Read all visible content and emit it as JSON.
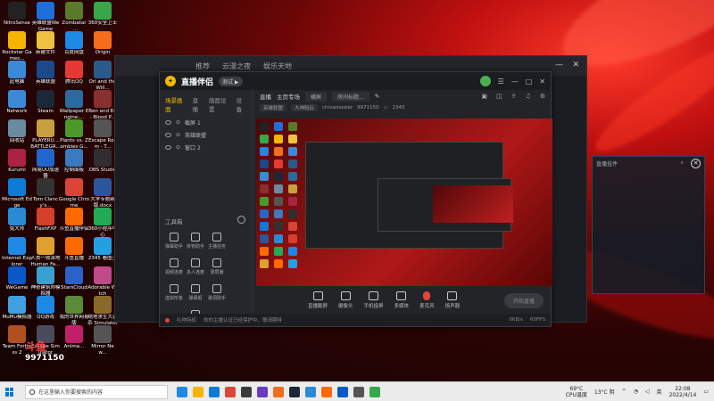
{
  "desktop_icons": [
    {
      "label": "NitroSense",
      "color": "#222222"
    },
    {
      "label": "英雄联盟WeGame",
      "color": "#1e6fd9"
    },
    {
      "label": "Zombatar_...",
      "color": "#5a7a2a"
    },
    {
      "label": "360安全卫士",
      "color": "#36a84a"
    },
    {
      "label": "Rockstar Games...",
      "color": "#f4b400"
    },
    {
      "label": "新建文件",
      "color": "#f0c040"
    },
    {
      "label": "百度网盘",
      "color": "#1e88e5"
    },
    {
      "label": "Origin",
      "color": "#f56c1d"
    },
    {
      "label": "此电脑",
      "color": "#3a8ad6"
    },
    {
      "label": "英雄联盟",
      "color": "#1b4a8a"
    },
    {
      "label": "腾讯QQ",
      "color": "#e53935"
    },
    {
      "label": "Ori and the Will...",
      "color": "#2a5a8a"
    },
    {
      "label": "Network",
      "color": "#3a8ad6"
    },
    {
      "label": "Steam",
      "color": "#1b2838"
    },
    {
      "label": "Wallpaper Engine:...",
      "color": "#2a6aa0"
    },
    {
      "label": "Ben and Ed - Blood P...",
      "color": "#883030"
    },
    {
      "label": "回收站",
      "color": "#6a8aa0"
    },
    {
      "label": "PLAYERU... BATTLEGR...",
      "color": "#c8a040"
    },
    {
      "label": "Plants vs. Zombies G...",
      "color": "#4a9a2a"
    },
    {
      "label": "Escape Room - T...",
      "color": "#555555"
    },
    {
      "label": "Kurumi",
      "color": "#aa2244"
    },
    {
      "label": "网易UU加速器",
      "color": "#2266cc"
    },
    {
      "label": "控制面板",
      "color": "#3a7ac0"
    },
    {
      "label": "OBS Studio",
      "color": "#302e31"
    },
    {
      "label": "Microsoft Edge",
      "color": "#0c7bd6"
    },
    {
      "label": "Tom Clancy's...",
      "color": "#333333"
    },
    {
      "label": "Google Chrome",
      "color": "#db4437"
    },
    {
      "label": "大学专题新版.docx",
      "color": "#2b579a"
    },
    {
      "label": "兔大师",
      "color": "#2a8ad6"
    },
    {
      "label": "FlashFXP",
      "color": "#d6402a"
    },
    {
      "label": "斗鱼直播伴侣",
      "color": "#ff6a00"
    },
    {
      "label": "360小程序中心",
      "color": "#22aa55"
    },
    {
      "label": "Internet Explorer",
      "color": "#1e88e5"
    },
    {
      "label": "人类一败涂地 Human Fa...",
      "color": "#e0a030"
    },
    {
      "label": "斗鱼直播",
      "color": "#ff6a00"
    },
    {
      "label": "2345 看图王",
      "color": "#22a0e0"
    },
    {
      "label": "WeGame",
      "color": "#0a58c8"
    },
    {
      "label": "神奇建筑师模拟器",
      "color": "#3aa0d0"
    },
    {
      "label": "StarsCloud",
      "color": "#2a62c8"
    },
    {
      "label": "Adorable Witch",
      "color": "#c04a8a"
    },
    {
      "label": "MuMu模拟器",
      "color": "#40a0e0"
    },
    {
      "label": "QQ游戏",
      "color": "#1e88e5"
    },
    {
      "label": "我的世界网易版",
      "color": "#5a8a3a"
    },
    {
      "label": "绝地求生大逃杀 Simulator",
      "color": "#8a6a2a"
    },
    {
      "label": "Team Fortress 2",
      "color": "#b05020"
    },
    {
      "label": "Escape Simulator",
      "color": "#4a4a5a"
    },
    {
      "label": "Anima...",
      "color": "#c0206a"
    },
    {
      "label": "Mirror New...",
      "color": "#555555"
    }
  ],
  "bg_window": {
    "tabs": [
      "推荐",
      "云漫之夜",
      "娱乐天地"
    ],
    "min": "—",
    "close": "✕"
  },
  "app": {
    "name": "直播伴侣",
    "version_badge": "测试 ▶",
    "side_tabs": [
      "场景画面",
      "直播",
      "画面设置",
      "设备"
    ],
    "scenes": [
      "截屏 1",
      "英雄联盟",
      "窗口 2"
    ],
    "toolbox_title": "工具箱",
    "tools": [
      "弹幕助手",
      "房管助手",
      "主播任务",
      "",
      "视频连麦",
      "多人连麦",
      "录屏播",
      "",
      "虚拟形象",
      "弹幕姬",
      "歌词助手",
      "",
      "",
      "直播美颜",
      "",
      ""
    ],
    "room_label": "直播",
    "room_category": "主页专场",
    "room_mode": "横屏",
    "room_title_placeholder": "房间标题...",
    "tags": [
      "英雄联盟",
      "大神陪玩",
      "chivamaster",
      "9971150"
    ],
    "hot_value": "2345",
    "controls": [
      "直播截屏",
      "摄像头",
      "手机投屏",
      "多媒体",
      "麦克风",
      "扬声器"
    ],
    "start_label": "开始直播",
    "status_text": "礼物特权",
    "status_hint": "你的主播认证已经保护中，敬请期待",
    "right_status": "0KB/s",
    "bottom_right": "60FPS"
  },
  "overlay": {
    "title": "直播挂件",
    "close": "✕"
  },
  "watermark": {
    "logo": "斗鱼",
    "room_number": "9971150"
  },
  "taskbar": {
    "search_placeholder": "在这里输入你要搜索的内容",
    "cpu_temp": "69°C",
    "cpu_label": "CPU温度",
    "weather": "13°C 阴",
    "ime": "英",
    "time": "22:08",
    "date": "2022/4/14",
    "apps": [
      "#1e88e5",
      "#f4b400",
      "#0c7bd6",
      "#db4437",
      "#3a3a3a",
      "#6a3ac0",
      "#f56c1d",
      "#1b2838",
      "#2a8ad6",
      "#ff6a00",
      "#0a58c8",
      "#555555",
      "#36a84a"
    ]
  }
}
